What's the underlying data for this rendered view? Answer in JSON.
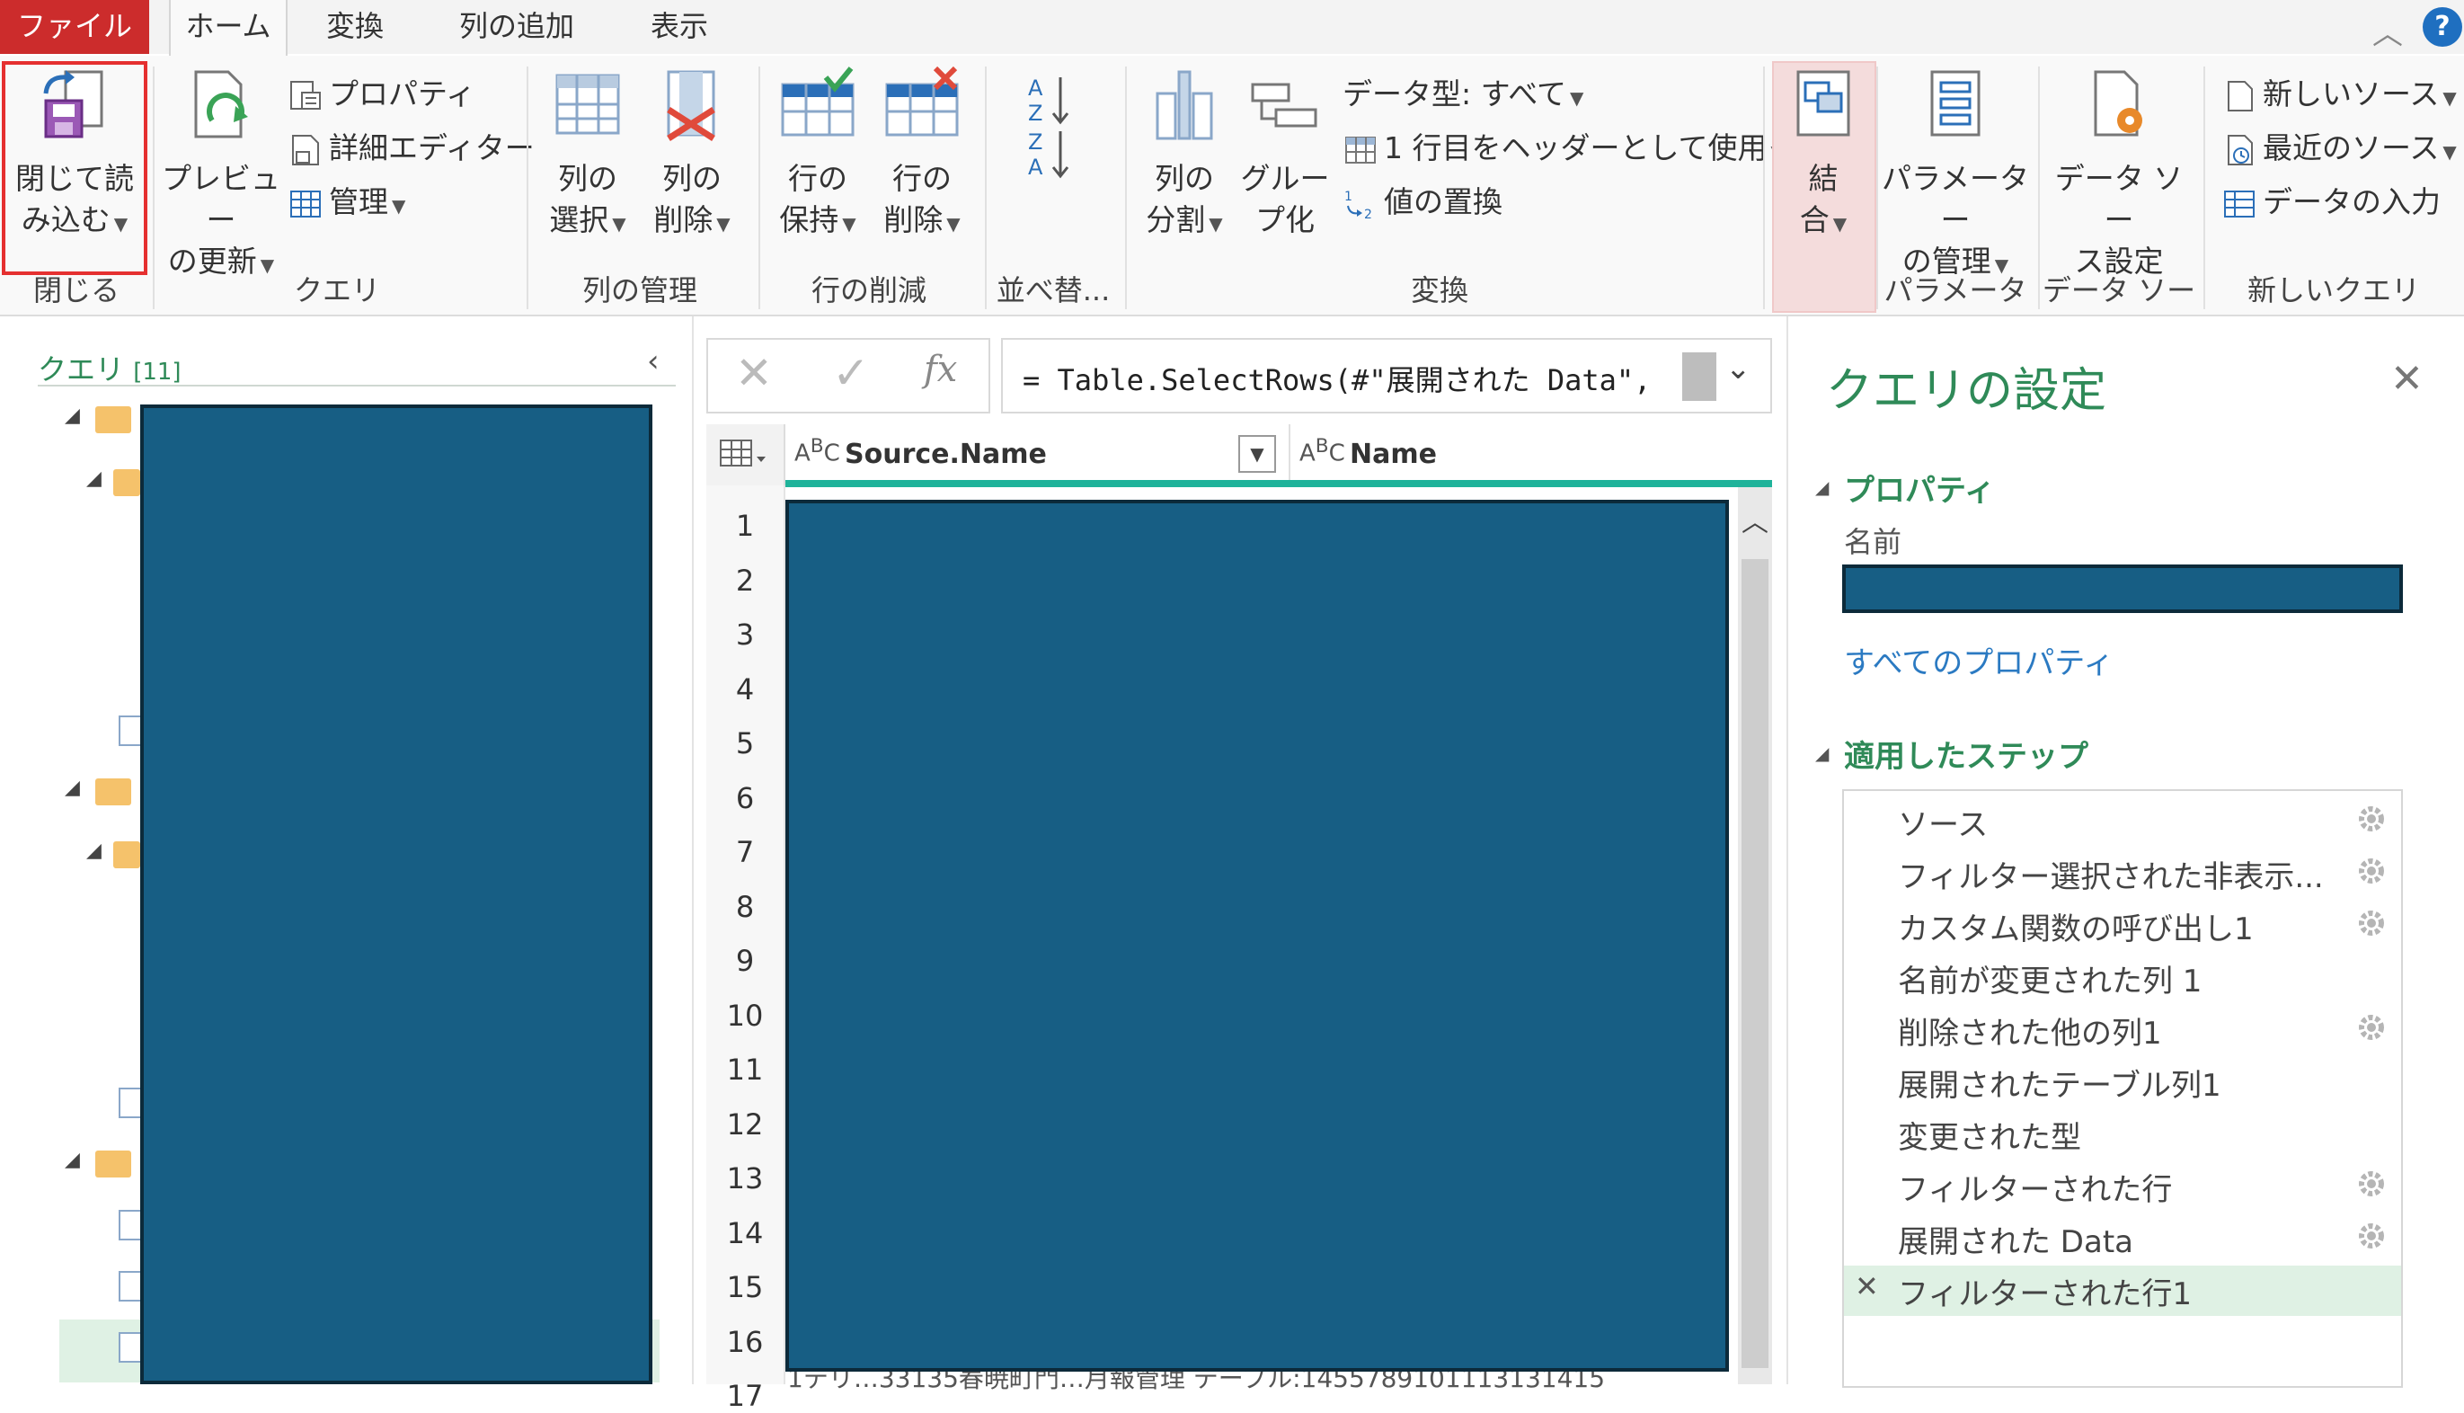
{
  "tabs": [
    "ファイル",
    "ホーム",
    "変換",
    "列の追加",
    "表示"
  ],
  "ribbon": {
    "close_load": {
      "line1": "閉じて読",
      "line2": "み込む"
    },
    "refresh": {
      "line1": "プレビュー",
      "line2": "の更新"
    },
    "properties": "プロパティ",
    "advanced_editor": "詳細エディター",
    "manage": "管理",
    "choose_cols": {
      "line1": "列の",
      "line2": "選択"
    },
    "remove_cols": {
      "line1": "列の",
      "line2": "削除"
    },
    "keep_rows": {
      "line1": "行の",
      "line2": "保持"
    },
    "remove_rows": {
      "line1": "行の",
      "line2": "削除"
    },
    "split_col": {
      "line1": "列の",
      "line2": "分割"
    },
    "group_by": {
      "line1": "グルー",
      "line2": "プ化"
    },
    "data_type": "データ型: すべて",
    "first_row_header": "1 行目をヘッダーとして使用",
    "replace_values": "値の置換",
    "combine": {
      "line1": "結",
      "line2": "合"
    },
    "manage_params": {
      "line1": "パラメーター",
      "line2": "の管理"
    },
    "datasource_settings": {
      "line1": "データ ソー",
      "line2": "ス設定"
    },
    "new_source": "新しいソース",
    "recent_sources": "最近のソース",
    "enter_data": "データの入力",
    "groups": {
      "close": "閉じる",
      "query": "クエリ",
      "manage_cols": "列の管理",
      "reduce_rows": "行の削減",
      "sort": "並べ替...",
      "transform": "変換",
      "params": "パラメーター",
      "datasource": "データ ソース",
      "new_query": "新しいクエリ"
    }
  },
  "queries": {
    "title": "クエリ",
    "count": "[11]"
  },
  "formula": {
    "text": "= Table.SelectRows(#\"展開された Data\","
  },
  "grid": {
    "columns": [
      "Source.Name",
      "Name"
    ],
    "rows": [
      "1",
      "2",
      "3",
      "4",
      "5",
      "6",
      "7",
      "8",
      "9",
      "10",
      "11",
      "12",
      "13",
      "14",
      "15",
      "16",
      "17"
    ],
    "partial_row_text": "1テリ…33135春暁町門…月報管理      テーブル:1455789101113131415"
  },
  "settings": {
    "title": "クエリの設定",
    "properties_header": "プロパティ",
    "name_label": "名前",
    "all_properties": "すべてのプロパティ",
    "steps_header": "適用したステップ",
    "steps": [
      {
        "label": "ソース",
        "gear": true
      },
      {
        "label": "フィルター選択された非表示...",
        "gear": true
      },
      {
        "label": "カスタム関数の呼び出し1",
        "gear": true
      },
      {
        "label": "名前が変更された列 1",
        "gear": false
      },
      {
        "label": "削除された他の列1",
        "gear": true
      },
      {
        "label": "展開されたテーブル列1",
        "gear": false
      },
      {
        "label": "変更された型",
        "gear": false
      },
      {
        "label": "フィルターされた行",
        "gear": true
      },
      {
        "label": "展開された Data",
        "gear": true
      },
      {
        "label": "フィルターされた行1",
        "gear": false,
        "selected": true
      }
    ]
  },
  "colors": {
    "accent": "#217346",
    "file_red": "#cc2c2c",
    "redact": "#175e84",
    "highlight": "#e53030"
  }
}
